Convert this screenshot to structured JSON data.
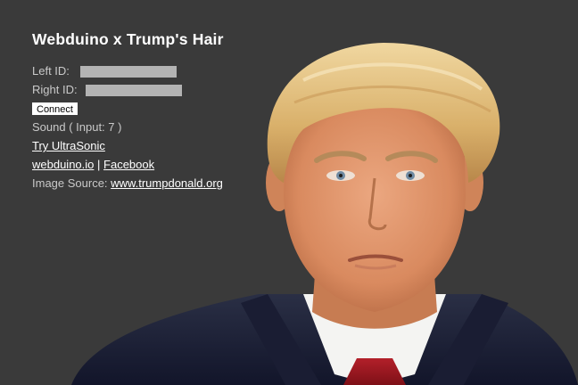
{
  "page": {
    "title": "Webduino x Trump's Hair",
    "left_id_label": "Left ID:",
    "right_id_label": "Right ID:",
    "connect_label": "Connect",
    "sound_text": "Sound ( Input: 7 )",
    "ultrasonic_link": "Try UltraSonic",
    "webduino_link": "webduino.io",
    "link_separator": "|",
    "facebook_link": "Facebook",
    "image_source_label": "Image Source:",
    "image_source_link": "www.trumpdonald.org"
  },
  "colors": {
    "background": "#3a3a3a",
    "input_fill": "#b3b3b3",
    "text": "#c9c9c9",
    "link": "#ffffff"
  }
}
